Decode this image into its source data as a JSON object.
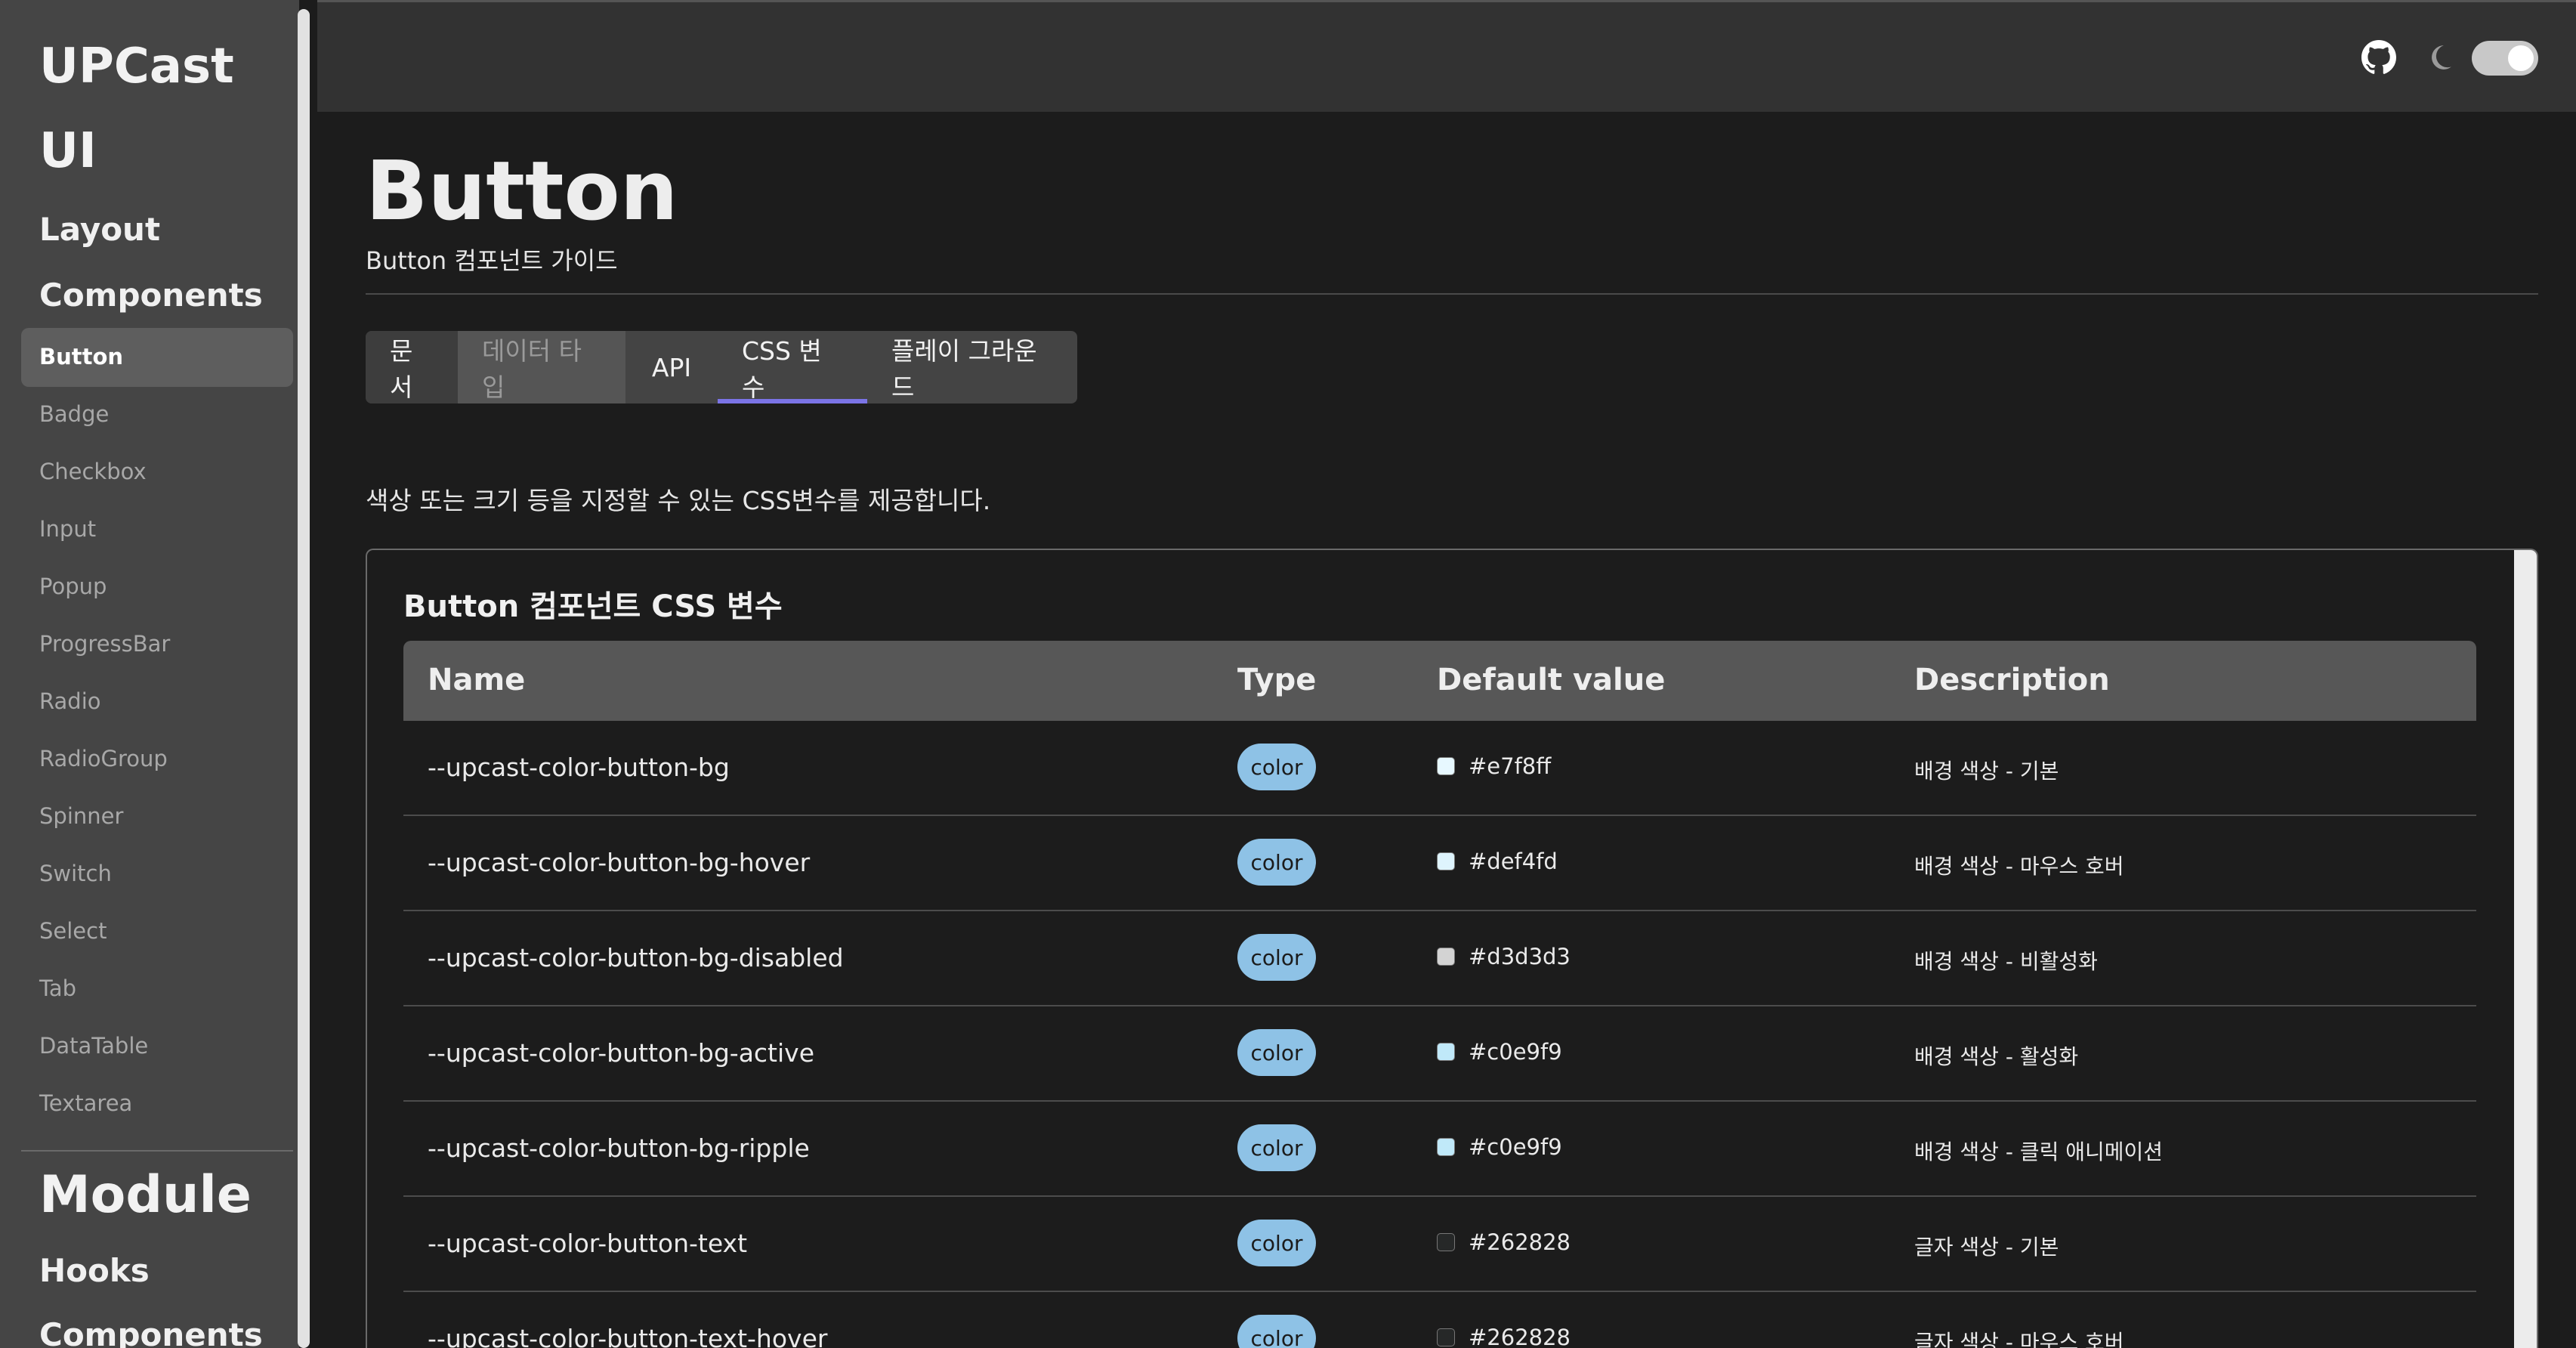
{
  "sidebar": {
    "title_line1": "UPCast",
    "title_line2": "UI",
    "groups": {
      "layout": "Layout",
      "components": "Components",
      "module": "Module",
      "hooks": "Hooks",
      "module_components": "Components"
    },
    "items": [
      {
        "label": "Button",
        "active": true
      },
      {
        "label": "Badge"
      },
      {
        "label": "Checkbox"
      },
      {
        "label": "Input"
      },
      {
        "label": "Popup"
      },
      {
        "label": "ProgressBar"
      },
      {
        "label": "Radio"
      },
      {
        "label": "RadioGroup"
      },
      {
        "label": "Spinner"
      },
      {
        "label": "Switch"
      },
      {
        "label": "Select"
      },
      {
        "label": "Tab"
      },
      {
        "label": "DataTable"
      },
      {
        "label": "Textarea"
      }
    ]
  },
  "topbar": {
    "github_icon": "github-icon",
    "moon_icon": "moon-icon",
    "theme_toggle_on": true
  },
  "page": {
    "title": "Button",
    "subtitle": "Button 컴포넌트 가이드",
    "tabs": [
      {
        "label": "문서"
      },
      {
        "label": "데이터 타입",
        "disabled": true
      },
      {
        "label": "API"
      },
      {
        "label": "CSS 변수",
        "active": true
      },
      {
        "label": "플레이 그라운드"
      }
    ],
    "description": "색상 또는 크기 등을 지정할 수 있는 CSS변수를 제공합니다."
  },
  "table": {
    "title": "Button 컴포넌트 CSS 변수",
    "headers": {
      "name": "Name",
      "type": "Type",
      "default": "Default value",
      "description": "Description"
    },
    "rows": [
      {
        "name": "--upcast-color-button-bg",
        "type": "color",
        "default": "#e7f8ff",
        "description": "배경 색상 - 기본"
      },
      {
        "name": "--upcast-color-button-bg-hover",
        "type": "color",
        "default": "#def4fd",
        "description": "배경 색상 - 마우스 호버"
      },
      {
        "name": "--upcast-color-button-bg-disabled",
        "type": "color",
        "default": "#d3d3d3",
        "description": "배경 색상 - 비활성화"
      },
      {
        "name": "--upcast-color-button-bg-active",
        "type": "color",
        "default": "#c0e9f9",
        "description": "배경 색상 - 활성화"
      },
      {
        "name": "--upcast-color-button-bg-ripple",
        "type": "color",
        "default": "#c0e9f9",
        "description": "배경 색상 - 클릭 애니메이션"
      },
      {
        "name": "--upcast-color-button-text",
        "type": "color",
        "default": "#262828",
        "description": "글자 색상 - 기본"
      },
      {
        "name": "--upcast-color-button-text-hover",
        "type": "color",
        "default": "#262828",
        "description": "글자 색상 - 마우스 호버"
      }
    ]
  },
  "colors": {
    "accent": "#7b74e6",
    "badge": "#8ec2e6",
    "sidebar_bg": "#454545",
    "page_bg": "#1c1c1c"
  }
}
